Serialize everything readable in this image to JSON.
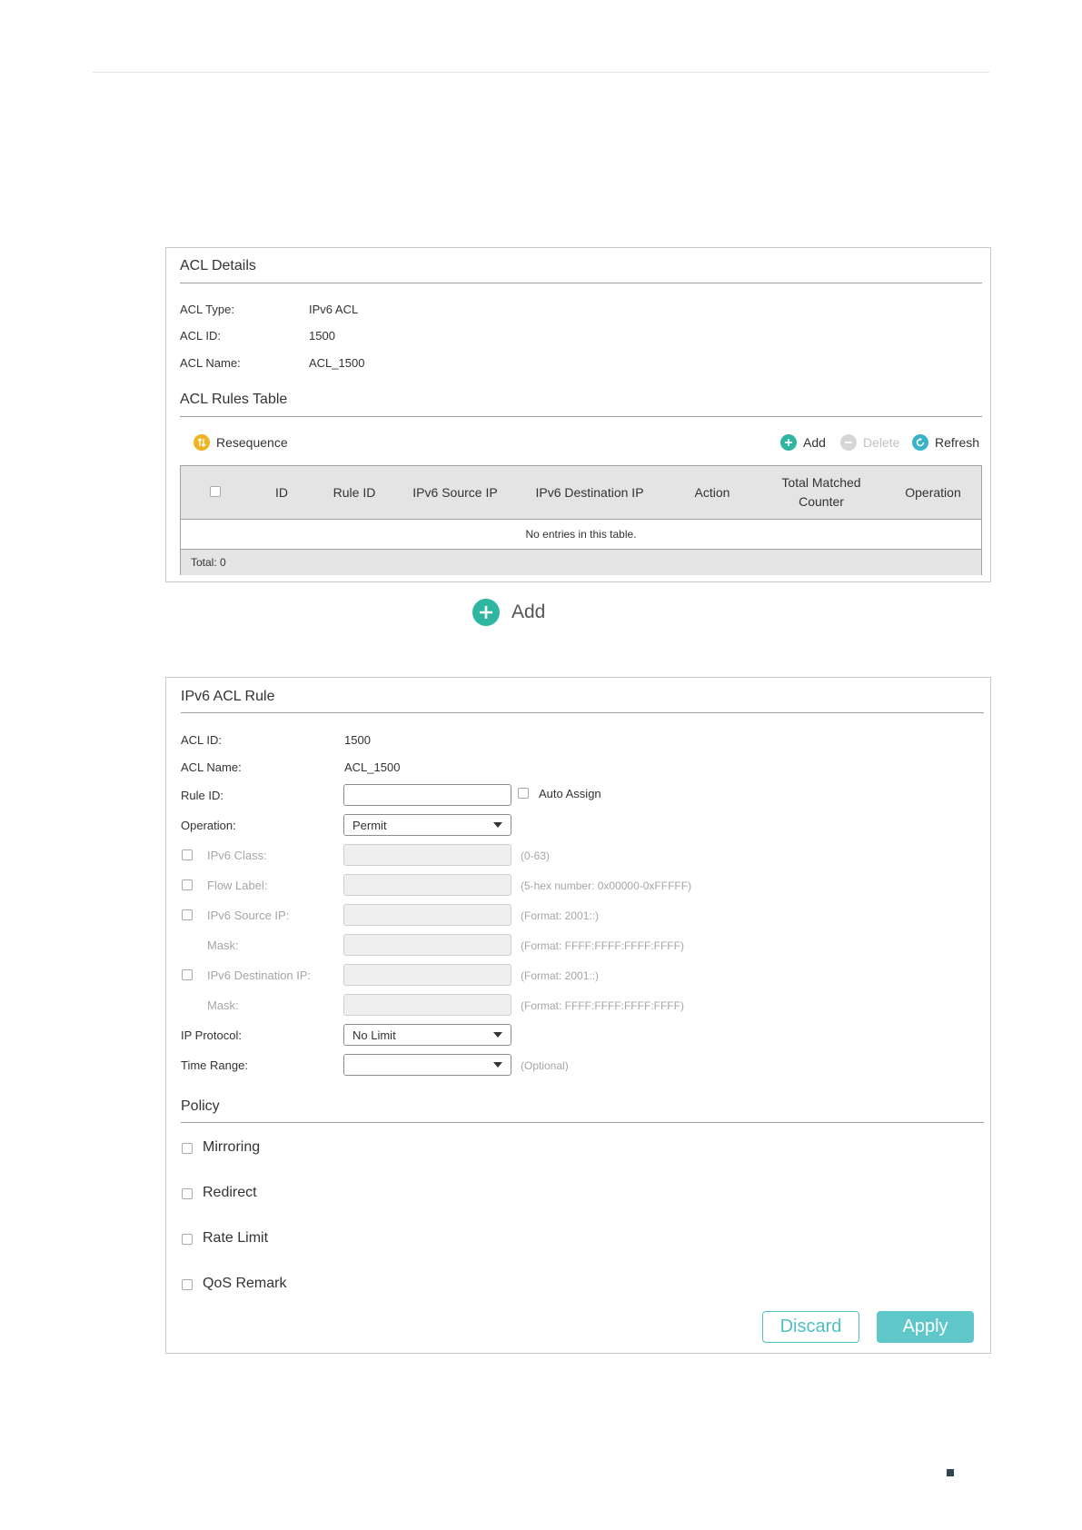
{
  "colors": {
    "accent": "#4fc1c3",
    "add_green": "#2fb6a0",
    "resequence_yellow": "#f0b323",
    "refresh_teal": "#38b3c7",
    "disabled_gray": "#cccccc"
  },
  "acl_details": {
    "title": "ACL Details",
    "rows": [
      {
        "label": "ACL Type:",
        "value": "IPv6 ACL"
      },
      {
        "label": "ACL ID:",
        "value": "1500"
      },
      {
        "label": "ACL Name:",
        "value": "ACL_1500"
      }
    ]
  },
  "rules_table": {
    "title": "ACL Rules Table",
    "toolbar": {
      "resequence": "Resequence",
      "add": "Add",
      "delete": "Delete",
      "refresh": "Refresh"
    },
    "columns": {
      "id": "ID",
      "rule_id": "Rule ID",
      "ipv6_source_ip": "IPv6 Source IP",
      "ipv6_destination_ip": "IPv6 Destination IP",
      "action": "Action",
      "counter_line1": "Total Matched",
      "counter_line2": "Counter",
      "operation": "Operation"
    },
    "empty_message": "No entries in this table.",
    "total": "Total: 0"
  },
  "callout": {
    "label": "Add"
  },
  "rule_form": {
    "title": "IPv6 ACL Rule",
    "acl_id_label": "ACL ID:",
    "acl_id_value": "1500",
    "acl_name_label": "ACL Name:",
    "acl_name_value": "ACL_1500",
    "rule_id_label": "Rule ID:",
    "rule_id_value": "",
    "auto_assign_label": "Auto Assign",
    "operation_label": "Operation:",
    "operation_value": "Permit",
    "ipv6_class_label": "IPv6 Class:",
    "ipv6_class_hint": "(0-63)",
    "flow_label_label": "Flow Label:",
    "flow_label_hint": "(5-hex number: 0x00000-0xFFFFF)",
    "source_ip_label": "IPv6 Source IP:",
    "source_ip_hint": "(Format: 2001::)",
    "source_mask_label": "Mask:",
    "source_mask_hint": "(Format: FFFF:FFFF:FFFF:FFFF)",
    "dest_ip_label": "IPv6 Destination IP:",
    "dest_ip_hint": "(Format: 2001::)",
    "dest_mask_label": "Mask:",
    "dest_mask_hint": "(Format: FFFF:FFFF:FFFF:FFFF)",
    "ip_protocol_label": "IP Protocol:",
    "ip_protocol_value": "No Limit",
    "time_range_label": "Time Range:",
    "time_range_value": "",
    "time_range_hint": "(Optional)"
  },
  "policy": {
    "title": "Policy",
    "items": [
      "Mirroring",
      "Redirect",
      "Rate Limit",
      "QoS Remark"
    ]
  },
  "buttons": {
    "discard": "Discard",
    "apply": "Apply"
  }
}
